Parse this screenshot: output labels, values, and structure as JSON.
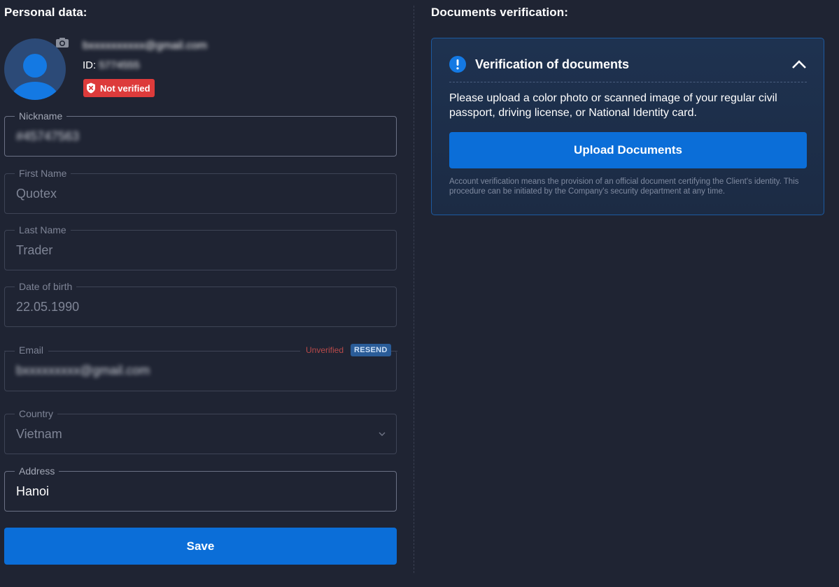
{
  "personal": {
    "title": "Personal data:",
    "profile": {
      "email_masked": "bxxxxxxxxxx@gmail.com",
      "id_label": "ID:",
      "id_masked": "5774555",
      "status_badge": "Not verified"
    },
    "fields": {
      "nickname": {
        "label": "Nickname",
        "value": "#45747563"
      },
      "first_name": {
        "label": "First Name",
        "value": "Quotex"
      },
      "last_name": {
        "label": "Last Name",
        "value": "Trader"
      },
      "dob": {
        "label": "Date of birth",
        "value": "22.05.1990"
      },
      "email": {
        "label": "Email",
        "value": "bxxxxxxxxx@gmail.com",
        "status": "Unverified",
        "resend": "RESEND"
      },
      "country": {
        "label": "Country",
        "value": "Vietnam"
      },
      "address": {
        "label": "Address",
        "value": "Hanoi"
      }
    },
    "save_label": "Save"
  },
  "documents": {
    "title": "Documents verification:",
    "card": {
      "title": "Verification of documents",
      "text": "Please upload a color photo or scanned image of your regular civil passport, driving license, or National Identity card.",
      "upload_label": "Upload Documents",
      "footnote": "Account verification means the provision of an official document certifying the Client's identity. This procedure can be initiated by the Company's security department at any time."
    }
  },
  "icons": {
    "camera": "camera-icon",
    "shield": "shield-x-icon",
    "chevron": "chevron-down-icon",
    "info": "info-icon",
    "collapse": "chevron-up-icon"
  },
  "colors": {
    "background": "#1f2433",
    "accent": "#0b6ed8",
    "danger": "#dd3b3b",
    "card_border": "#1d5aa0"
  }
}
